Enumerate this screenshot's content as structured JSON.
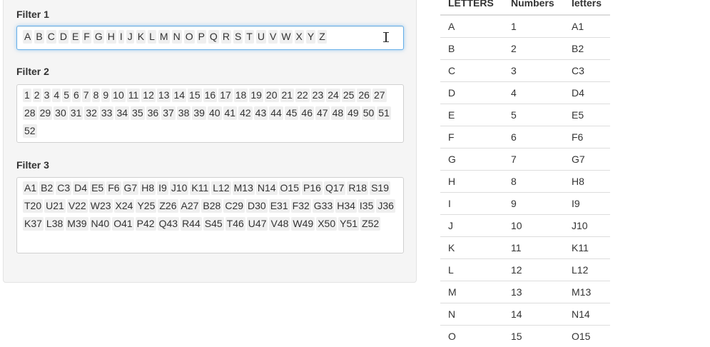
{
  "filters": [
    {
      "label": "Filter 1",
      "values": [
        "A",
        "B",
        "C",
        "D",
        "E",
        "F",
        "G",
        "H",
        "I",
        "J",
        "K",
        "L",
        "M",
        "N",
        "O",
        "P",
        "Q",
        "R",
        "S",
        "T",
        "U",
        "V",
        "W",
        "X",
        "Y",
        "Z"
      ]
    },
    {
      "label": "Filter 2",
      "values": [
        "1",
        "2",
        "3",
        "4",
        "5",
        "6",
        "7",
        "8",
        "9",
        "10",
        "11",
        "12",
        "13",
        "14",
        "15",
        "16",
        "17",
        "18",
        "19",
        "20",
        "21",
        "22",
        "23",
        "24",
        "25",
        "26",
        "27",
        "28",
        "29",
        "30",
        "31",
        "32",
        "33",
        "34",
        "35",
        "36",
        "37",
        "38",
        "39",
        "40",
        "41",
        "42",
        "43",
        "44",
        "45",
        "46",
        "47",
        "48",
        "49",
        "50",
        "51",
        "52"
      ]
    },
    {
      "label": "Filter 3",
      "values": [
        "A1",
        "B2",
        "C3",
        "D4",
        "E5",
        "F6",
        "G7",
        "H8",
        "I9",
        "J10",
        "K11",
        "L12",
        "M13",
        "N14",
        "O15",
        "P16",
        "Q17",
        "R18",
        "S19",
        "T20",
        "U21",
        "V22",
        "W23",
        "X24",
        "Y25",
        "Z26",
        "A27",
        "B28",
        "C29",
        "D30",
        "E31",
        "F32",
        "G33",
        "H34",
        "I35",
        "J36",
        "K37",
        "L38",
        "M39",
        "N40",
        "O41",
        "P42",
        "Q43",
        "R44",
        "S45",
        "T46",
        "U47",
        "V48",
        "W49",
        "X50",
        "Y51",
        "Z52"
      ]
    }
  ],
  "table": {
    "columns": [
      "LETTERS",
      "Numbers",
      "letters"
    ],
    "rows": [
      [
        "A",
        "1",
        "A1"
      ],
      [
        "B",
        "2",
        "B2"
      ],
      [
        "C",
        "3",
        "C3"
      ],
      [
        "D",
        "4",
        "D4"
      ],
      [
        "E",
        "5",
        "E5"
      ],
      [
        "F",
        "6",
        "F6"
      ],
      [
        "G",
        "7",
        "G7"
      ],
      [
        "H",
        "8",
        "H8"
      ],
      [
        "I",
        "9",
        "I9"
      ],
      [
        "J",
        "10",
        "J10"
      ],
      [
        "K",
        "11",
        "K11"
      ],
      [
        "L",
        "12",
        "L12"
      ],
      [
        "M",
        "13",
        "M13"
      ],
      [
        "N",
        "14",
        "N14"
      ],
      [
        "O",
        "15",
        "O15"
      ]
    ]
  },
  "icons": {
    "cursor": "text-cursor-icon"
  }
}
